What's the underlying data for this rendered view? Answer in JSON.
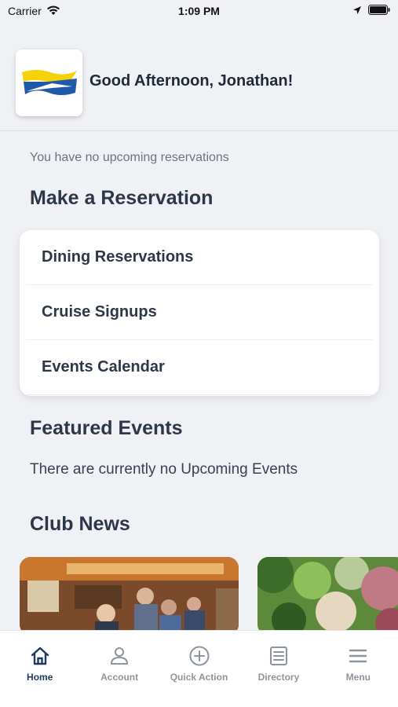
{
  "status_bar": {
    "carrier": "Carrier",
    "time": "1:09 PM"
  },
  "header": {
    "greeting": "Good Afternoon, Jonathan!"
  },
  "reservations": {
    "empty_text": "You have no upcoming reservations",
    "section_title": "Make a Reservation",
    "items": [
      {
        "label": "Dining Reservations"
      },
      {
        "label": "Cruise Signups"
      },
      {
        "label": "Events Calendar"
      }
    ]
  },
  "featured_events": {
    "title": "Featured Events",
    "empty_text": "There are currently no Upcoming Events"
  },
  "club_news": {
    "title": "Club News"
  },
  "tab_bar": {
    "tabs": [
      {
        "label": "Home",
        "icon": "home-icon",
        "active": true
      },
      {
        "label": "Account",
        "icon": "person-icon",
        "active": false
      },
      {
        "label": "Quick Action",
        "icon": "plus-circle-icon",
        "active": false
      },
      {
        "label": "Directory",
        "icon": "list-document-icon",
        "active": false
      },
      {
        "label": "Menu",
        "icon": "hamburger-icon",
        "active": false
      }
    ]
  },
  "colors": {
    "background": "#eff1f5",
    "active_tab": "#1e3a5f",
    "inactive_tab": "#8e949c",
    "logo_yellow": "#f5d10a",
    "logo_blue": "#1f5aa8"
  }
}
